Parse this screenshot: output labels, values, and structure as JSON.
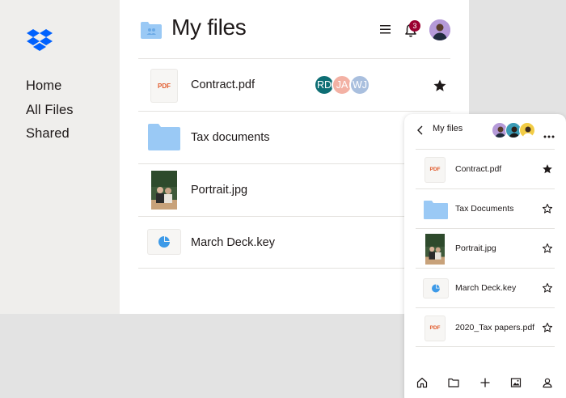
{
  "sidebar": {
    "logo": "dropbox-logo",
    "items": [
      {
        "label": "Home"
      },
      {
        "label": "All Files"
      },
      {
        "label": "Shared"
      }
    ]
  },
  "header": {
    "title": "My files",
    "notification_count": "3",
    "icons": [
      "folder-icon",
      "menu-icon",
      "bell-icon",
      "avatar"
    ]
  },
  "files": [
    {
      "name": "Contract.pdf",
      "type": "pdf",
      "type_label": "PDF",
      "starred": true,
      "collaborators": [
        {
          "initials": "RD",
          "color": "#0e6e74"
        },
        {
          "initials": "JA",
          "color": "#f3b1a4"
        },
        {
          "initials": "WJ",
          "color": "#a9bfde"
        }
      ]
    },
    {
      "name": "Tax documents",
      "type": "folder",
      "starred": false
    },
    {
      "name": "Portrait.jpg",
      "type": "image",
      "starred": false
    },
    {
      "name": "March Deck.key",
      "type": "keynote",
      "starred": false
    }
  ],
  "mobile": {
    "title": "My files",
    "files": [
      {
        "name": "Contract.pdf",
        "type": "pdf",
        "type_label": "PDF",
        "starred": true
      },
      {
        "name": "Tax Documents",
        "type": "folder",
        "starred": false
      },
      {
        "name": "Portrait.jpg",
        "type": "image",
        "starred": false
      },
      {
        "name": "March Deck.key",
        "type": "keynote",
        "starred": false
      },
      {
        "name": "2020_Tax papers.pdf",
        "type": "pdf",
        "type_label": "PDF",
        "starred": false
      }
    ],
    "tabbar": [
      "home-icon",
      "folder-icon",
      "plus-icon",
      "photos-icon",
      "account-icon"
    ]
  },
  "colors": {
    "accent_blue": "#0061fe",
    "folder_blue": "#9ac9f5",
    "pdf_orange": "#e15a2b",
    "badge_red": "#9b0032",
    "background": "#efeeec"
  }
}
